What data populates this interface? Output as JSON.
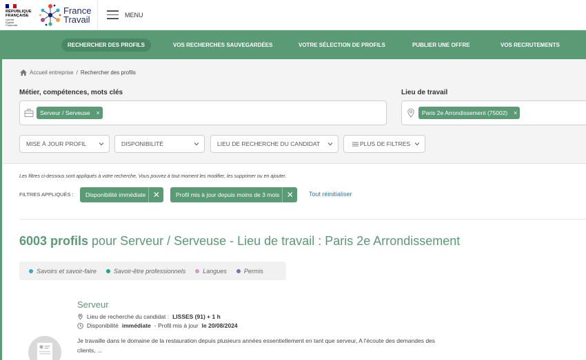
{
  "header": {
    "republic": [
      "RÉPUBLIQUE",
      "FRANÇAISE"
    ],
    "motto": [
      "Liberté",
      "Égalité",
      "Fraternité"
    ],
    "brand_line1": "France",
    "brand_line2": "Travail",
    "menu_label": "MENU"
  },
  "nav": {
    "items": [
      {
        "label": "RECHERCHER DES PROFILS",
        "active": true
      },
      {
        "label": "VOS RECHERCHES SAUVEGARDÉES",
        "active": false
      },
      {
        "label": "VOTRE SÉLECTION DE PROFILS",
        "active": false
      },
      {
        "label": "PUBLIER UNE OFFRE",
        "active": false
      },
      {
        "label": "VOS RECRUTEMENTS",
        "active": false
      }
    ]
  },
  "breadcrumb": {
    "home": "Accueil entreprise",
    "separator": "/",
    "current": "Rechercher des profils"
  },
  "search": {
    "job_label": "Métier, compétences, mots clés",
    "job_chip": "Serveur / Serveuse",
    "location_label": "Lieu de travail",
    "location_chip": "Paris 2e Arrondissement (75002)",
    "chip_remove": "×"
  },
  "filters": {
    "dropdowns": [
      "MISE À JOUR PROFIL",
      "DISPONIBILITÉ",
      "LIEU DE RECHERCHE DU CANDIDAT",
      "PLUS DE FILTRES"
    ],
    "note": "Les filtres ci-dessous sont appliqués à votre recherche. Vous pouvez à tout moment les modifier, les supprimer ou en ajouter.",
    "applied_label": "FILTRES APPLIQUÉS :",
    "applied": [
      "Disponibilité immédiate",
      "Profil mis à jour depuis moins de 3 mois"
    ],
    "remove": "✕",
    "reset": "Tout réinitialiser"
  },
  "results": {
    "count": "6003 profils",
    "rest": " pour Serveur / Serveuse - Lieu de travail : Paris 2e Arrondissement"
  },
  "legend": [
    {
      "label": "Savoirs et savoir-faire",
      "color": "#3aa6c4"
    },
    {
      "label": "Savoir-être professionnels",
      "color": "#1aa58c"
    },
    {
      "label": "Langues",
      "color": "#d49ac6"
    },
    {
      "label": "Permis",
      "color": "#7f6fb0"
    }
  ],
  "profile": {
    "title": "Serveur",
    "location_prefix": "Lieu de recherche du candidat :",
    "location_value": "LISSES (91) + 1 h",
    "availability_prefix": "Disponibilité",
    "availability_value": "immédiate",
    "updated_prefix": "- Profil mis à jour",
    "updated_value": "le 20/08/2024",
    "description": "Je travaille dans le domaine de la restauration depuis plusieurs années essentiellement en tant que serveur, A l'écoute des demandes des clients, ..."
  }
}
